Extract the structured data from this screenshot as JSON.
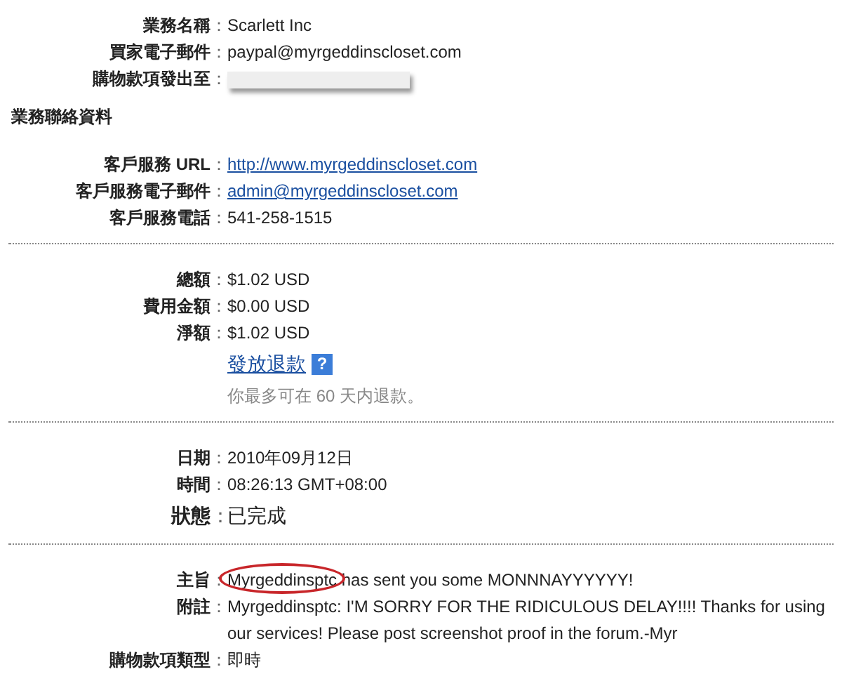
{
  "blocks": [
    {
      "kind": "rows",
      "rows": [
        {
          "kind": "text",
          "label": "業務名稱",
          "colon": "：",
          "value": "Scarlett Inc"
        },
        {
          "kind": "text",
          "label": "買家電子郵件",
          "colon": "：",
          "value": "paypal@myrgeddinscloset.com"
        },
        {
          "kind": "redacted",
          "label": "購物款項發出至",
          "colon": "："
        }
      ]
    },
    {
      "kind": "heading",
      "text": "業務聯絡資料"
    },
    {
      "kind": "rows",
      "rows": [
        {
          "kind": "link",
          "label": "客戶服務 URL",
          "colon": "：",
          "value": "http://www.myrgeddinscloset.com"
        },
        {
          "kind": "link",
          "label": "客戶服務電子郵件",
          "colon": "：",
          "value": "admin@myrgeddinscloset.com"
        },
        {
          "kind": "text",
          "label": "客戶服務電話",
          "colon": "：",
          "value": "541-258-1515"
        }
      ]
    },
    {
      "kind": "divider"
    },
    {
      "kind": "rows",
      "rows": [
        {
          "kind": "text",
          "label": "總額",
          "colon": "：",
          "value": "$1.02 USD"
        },
        {
          "kind": "text",
          "label": "費用金額",
          "colon": "：",
          "value": "$0.00 USD"
        },
        {
          "kind": "text",
          "label": "淨額",
          "colon": "：",
          "value": "$1.02 USD"
        },
        {
          "kind": "action",
          "value": "發放退款",
          "help": "?"
        },
        {
          "kind": "note",
          "value": "你最多可在 60 天内退款。"
        }
      ]
    },
    {
      "kind": "divider"
    },
    {
      "kind": "rows",
      "rows": [
        {
          "kind": "text",
          "label": "日期",
          "colon": "：",
          "value": "2010年09月12日"
        },
        {
          "kind": "text",
          "label": "時間",
          "colon": "：",
          "value": "08:26:13 GMT+08:00"
        },
        {
          "kind": "status",
          "label": "狀態",
          "colon": "：",
          "value": "已完成"
        }
      ]
    },
    {
      "kind": "divider"
    },
    {
      "kind": "rows",
      "rows": [
        {
          "kind": "text",
          "label": "主旨",
          "colon": "：",
          "value": "Myrgeddinsptc has sent you some MONNNAYYYYYY!",
          "circled": true
        },
        {
          "kind": "text",
          "label": "附註",
          "colon": "：",
          "value": "Myrgeddinsptc: I'M SORRY FOR THE RIDICULOUS DELAY!!!! Thanks for using our services! Please post screenshot proof in the forum.-Myr"
        },
        {
          "kind": "text",
          "label": "購物款項類型",
          "colon": "：",
          "value": "即時"
        }
      ]
    }
  ]
}
